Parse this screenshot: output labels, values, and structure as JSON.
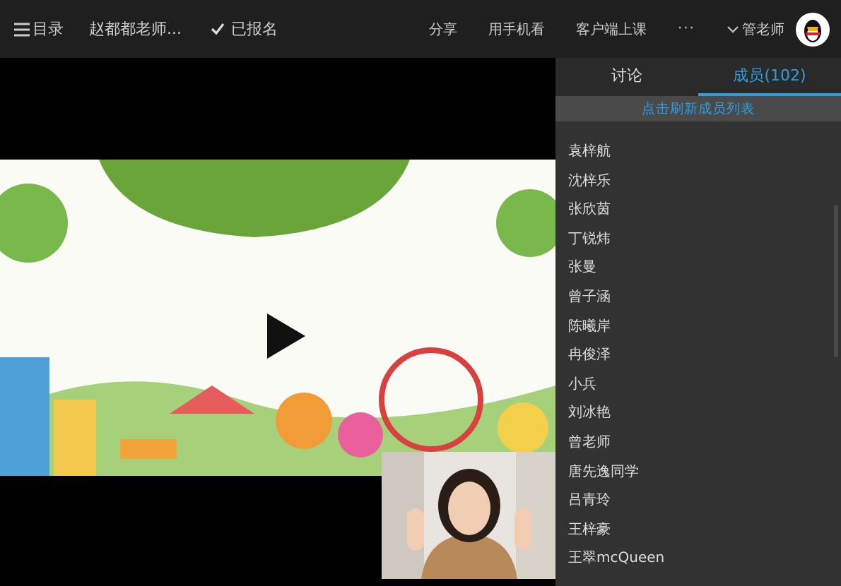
{
  "topbar": {
    "menu_label": "目录",
    "course_title": "赵都都老师...",
    "enrolled": {
      "label": "已报名",
      "checked": true
    },
    "actions": [
      "分享",
      "用手机看",
      "客户端上课"
    ],
    "more": "···",
    "user": {
      "name": "管老师"
    }
  },
  "panel": {
    "tabs": [
      {
        "label": "讨论",
        "selected": false
      },
      {
        "label": "成员(102)",
        "selected": true
      }
    ],
    "refresh_link": "点击刷新成员列表",
    "members": [
      "袁梓航",
      "沈梓乐",
      "张欣茵",
      "丁锐炜",
      "张曼",
      "曾子涵",
      "陈曦岸",
      "冉俊泽",
      "小兵",
      "刘冰艳",
      "曾老师",
      "唐先逸同学",
      "吕青玲",
      "王梓豪",
      "王翠mcQueen"
    ]
  }
}
